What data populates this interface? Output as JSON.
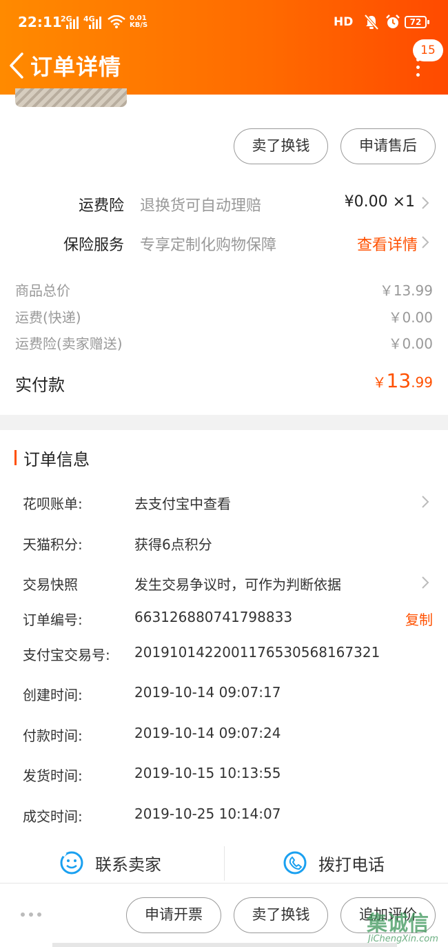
{
  "status_bar": {
    "time": "22:11",
    "network_top": "2G",
    "network_bottom": "4G",
    "speed_top": "0.01",
    "speed_bottom": "KB/S",
    "hd_label": "HD",
    "battery": "72"
  },
  "header": {
    "title": "订单详情",
    "message_count": "15",
    "accent_color": "#ff5000"
  },
  "action_buttons": {
    "sell": "卖了换钱",
    "after_sales": "申请售后"
  },
  "services": [
    {
      "label": "运费险",
      "desc": "退换货可自动理赔",
      "value": "¥0.00 ×1"
    },
    {
      "label": "保险服务",
      "desc": "专享定制化购物保障",
      "value": "查看详情"
    }
  ],
  "price_breakdown": [
    {
      "label": "商品总价",
      "value": "￥13.99"
    },
    {
      "label": "运费(快递)",
      "value": "￥0.00"
    },
    {
      "label": "运费险(卖家赠送)",
      "value": "￥0.00"
    }
  ],
  "paid": {
    "label": "实付款",
    "currency": "￥",
    "integer": "13",
    "decimal": ".99"
  },
  "order_info": {
    "title": "订单信息",
    "rows": [
      {
        "label": "花呗账单:",
        "value": "去支付宝中查看"
      },
      {
        "label": "天猫积分:",
        "value": "获得6点积分"
      },
      {
        "label": "交易快照",
        "value": "发生交易争议时，可作为判断依据"
      },
      {
        "label": "订单编号:",
        "value": "663126880741798833"
      },
      {
        "label": "支付宝交易号:",
        "value": "2019101422001176530568167321"
      },
      {
        "label": "创建时间:",
        "value": "2019-10-14 09:07:17"
      },
      {
        "label": "付款时间:",
        "value": "2019-10-14 09:07:24"
      },
      {
        "label": "发货时间:",
        "value": "2019-10-15 10:13:55"
      },
      {
        "label": "成交时间:",
        "value": "2019-10-25 10:14:07"
      }
    ],
    "copy_label": "复制"
  },
  "contact": {
    "seller": "联系卖家",
    "phone": "拨打电话"
  },
  "bottom_buttons": {
    "invoice": "申请开票",
    "sell": "卖了换钱",
    "review": "追加评价"
  },
  "watermark": {
    "cn": "集诚信",
    "en": "JiChengXin.com"
  }
}
